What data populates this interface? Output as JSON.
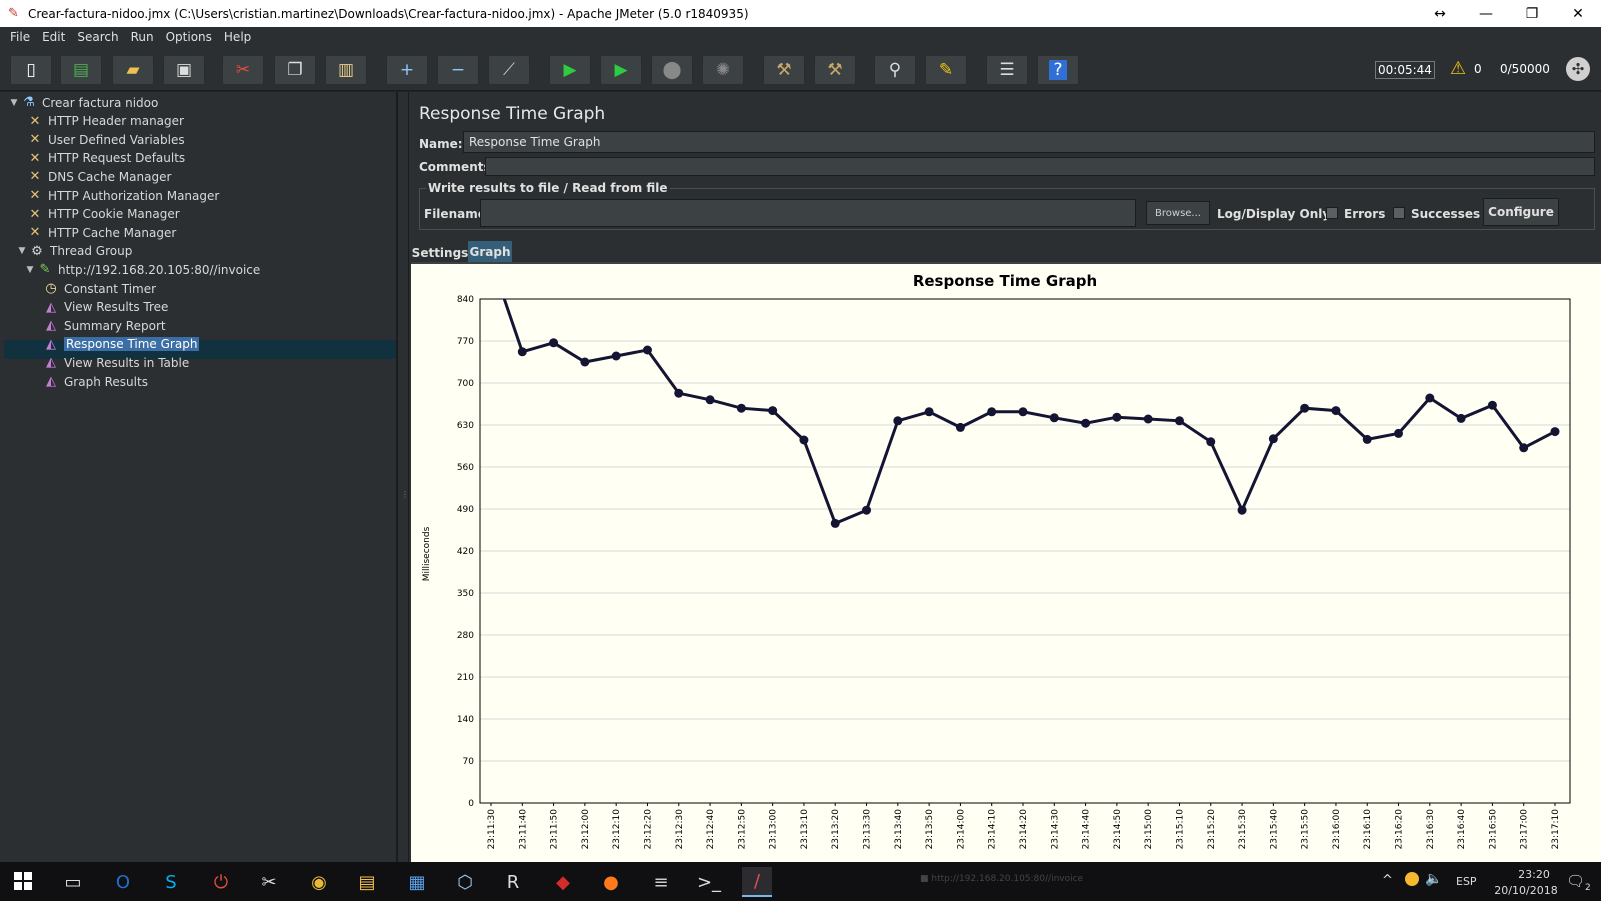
{
  "window": {
    "title": "Crear-factura-nidoo.jmx (C:\\Users\\cristian.martinez\\Downloads\\Crear-factura-nidoo.jmx) - Apache JMeter (5.0 r1840935)",
    "resize_glyph": "↔",
    "minimize_glyph": "—",
    "restore_glyph": "❐",
    "close_glyph": "✕"
  },
  "menu": [
    "File",
    "Edit",
    "Search",
    "Run",
    "Options",
    "Help"
  ],
  "toolbar": {
    "buttons": [
      "new-icon",
      "templates-icon",
      "open-icon",
      "save-icon",
      "cut-icon",
      "copy-icon",
      "paste-icon",
      "expand-icon",
      "collapse-icon",
      "toggle-icon",
      "start-icon",
      "start-no-pauses-icon",
      "stop-icon",
      "shutdown-icon",
      "clear-icon",
      "clear-all-icon",
      "search-icon",
      "reset-search-icon",
      "function-helper-icon",
      "help-icon"
    ],
    "timer": "00:05:44",
    "warning_count": "0",
    "threads": "0/50000",
    "colors": {
      "start": "#2ecc40",
      "stop": "#888888",
      "help": "#2f6fd6"
    }
  },
  "tree": {
    "items": [
      {
        "label": "Crear factura nidoo",
        "icon": "test-plan-icon",
        "level": 0,
        "expander": "▼"
      },
      {
        "label": "HTTP Header manager",
        "icon": "config-element-icon",
        "level": 1,
        "expander": ""
      },
      {
        "label": "User Defined Variables",
        "icon": "config-element-icon",
        "level": 1,
        "expander": ""
      },
      {
        "label": "HTTP Request Defaults",
        "icon": "config-element-icon",
        "level": 1,
        "expander": ""
      },
      {
        "label": "DNS Cache Manager",
        "icon": "config-element-icon",
        "level": 1,
        "expander": ""
      },
      {
        "label": "HTTP Authorization Manager",
        "icon": "config-element-icon",
        "level": 1,
        "expander": ""
      },
      {
        "label": "HTTP Cookie Manager",
        "icon": "config-element-icon",
        "level": 1,
        "expander": ""
      },
      {
        "label": "HTTP Cache Manager",
        "icon": "config-element-icon",
        "level": 1,
        "expander": ""
      },
      {
        "label": "Thread Group",
        "icon": "thread-group-icon",
        "level": 1,
        "expander": "▼"
      },
      {
        "label": "http://192.168.20.105:80//invoice",
        "icon": "sampler-icon",
        "level": 2,
        "expander": "▼"
      },
      {
        "label": "Constant Timer",
        "icon": "timer-icon",
        "level": 3,
        "expander": ""
      },
      {
        "label": "View Results Tree",
        "icon": "listener-icon",
        "level": 3,
        "expander": ""
      },
      {
        "label": "Summary Report",
        "icon": "listener-icon",
        "level": 3,
        "expander": ""
      },
      {
        "label": "Response Time Graph",
        "icon": "listener-icon",
        "level": 3,
        "expander": "",
        "selected": true
      },
      {
        "label": "View Results in Table",
        "icon": "listener-icon",
        "level": 3,
        "expander": ""
      },
      {
        "label": "Graph Results",
        "icon": "listener-icon",
        "level": 3,
        "expander": ""
      }
    ]
  },
  "panel": {
    "title": "Response Time Graph",
    "name_label": "Name:",
    "name_value": "Response Time Graph",
    "comments_label": "Comments:",
    "file_group_label": "Write results to file / Read from file",
    "filename_label": "Filename",
    "browse_label": "Browse...",
    "log_display_label": "Log/Display Only:",
    "errors_label": "Errors",
    "successes_label": "Successes",
    "configure_label": "Configure",
    "tabs": [
      "Settings",
      "Graph"
    ]
  },
  "chart_data": {
    "type": "line",
    "title": "Response Time Graph",
    "ylabel": "Milliseconds",
    "xlabel": "",
    "ylim": [
      0,
      840
    ],
    "yticks": [
      0,
      70,
      140,
      210,
      280,
      350,
      420,
      490,
      560,
      630,
      700,
      770,
      840
    ],
    "grid": "horizontal",
    "line_color": "#141433",
    "categories": [
      "23:11:30",
      "23:11:40",
      "23:11:50",
      "23:12:00",
      "23:12:10",
      "23:12:20",
      "23:12:30",
      "23:12:40",
      "23:12:50",
      "23:13:00",
      "23:13:10",
      "23:13:20",
      "23:13:30",
      "23:13:40",
      "23:13:50",
      "23:14:00",
      "23:14:10",
      "23:14:20",
      "23:14:30",
      "23:14:40",
      "23:14:50",
      "23:15:00",
      "23:15:10",
      "23:15:20",
      "23:15:30",
      "23:15:40",
      "23:15:50",
      "23:16:00",
      "23:16:10",
      "23:16:20",
      "23:16:30",
      "23:16:40",
      "23:16:50",
      "23:17:00",
      "23:17:10"
    ],
    "series": [
      {
        "name": "http://192.168.20.105:80//invoice",
        "values": [
          905,
          752,
          767,
          735,
          745,
          755,
          683,
          672,
          658,
          654,
          605,
          466,
          488,
          637,
          652,
          626,
          652,
          652,
          642,
          633,
          643,
          640,
          637,
          602,
          488,
          607,
          658,
          654,
          606,
          616,
          675,
          641,
          663,
          592,
          619
        ]
      }
    ]
  },
  "taskbar": {
    "apps": [
      {
        "name": "task-view-icon",
        "glyph": "▭"
      },
      {
        "name": "outlook-icon",
        "glyph": "O"
      },
      {
        "name": "skype-icon",
        "glyph": "S"
      },
      {
        "name": "power-app-icon",
        "glyph": "⏻"
      },
      {
        "name": "snipping-icon",
        "glyph": "✂"
      },
      {
        "name": "chrome-icon",
        "glyph": "◉"
      },
      {
        "name": "file-explorer-icon",
        "glyph": "▤"
      },
      {
        "name": "desktop-app-icon",
        "glyph": "▦"
      },
      {
        "name": "cube-app-icon",
        "glyph": "⬡"
      },
      {
        "name": "rd-app-icon",
        "glyph": "R"
      },
      {
        "name": "red-app-icon",
        "glyph": "◆"
      },
      {
        "name": "firefox-icon",
        "glyph": "●"
      },
      {
        "name": "notepad-icon",
        "glyph": "≡"
      },
      {
        "name": "terminal-icon",
        "glyph": ">_"
      },
      {
        "name": "jmeter-icon",
        "glyph": "/"
      }
    ],
    "legend_text": "http://192.168.20.105:80//invoice",
    "language": "ESP",
    "time": "23:20",
    "date": "20/10/2018",
    "notifications": "2"
  }
}
